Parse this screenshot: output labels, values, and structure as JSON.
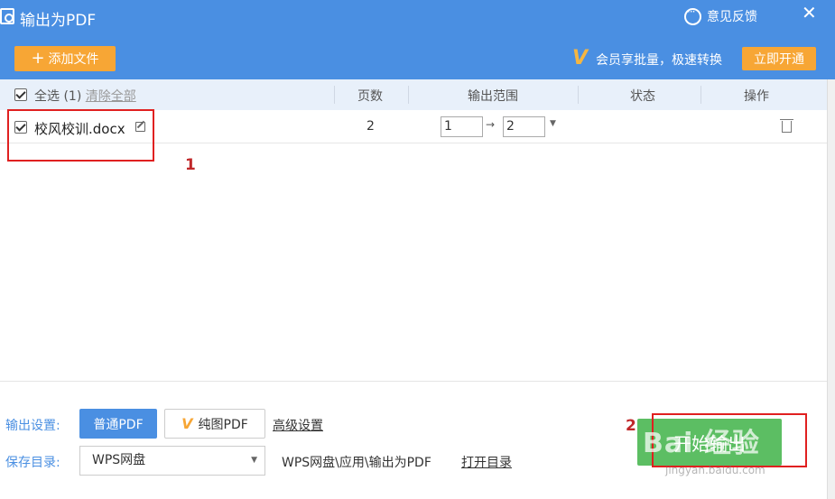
{
  "window": {
    "title": "输出为PDF",
    "feedback": "意见反馈",
    "close": "✕"
  },
  "toolbar": {
    "add_files": "添加文件",
    "vip_text": "会员享批量，极速转换",
    "open_vip": "立即开通"
  },
  "table": {
    "select_all": "全选 (1)",
    "clear_all": "清除全部",
    "columns": {
      "pages": "页数",
      "range": "输出范围",
      "status": "状态",
      "action": "操作"
    },
    "rows": [
      {
        "name": "校风校训.docx",
        "pages": "2",
        "range_from": "1",
        "range_to": "2",
        "checked": true
      }
    ]
  },
  "settings": {
    "output_label": "输出设置:",
    "mode_normal": "普通PDF",
    "mode_image": "纯图PDF",
    "advanced": "高级设置",
    "save_label": "保存目录:",
    "save_target": "WPS网盘",
    "save_path": "WPS网盘\\应用\\输出为PDF",
    "open_dir": "打开目录"
  },
  "start": {
    "label": "开始输出"
  },
  "annotations": {
    "n1": "1",
    "n2": "2",
    "color": "#e02020"
  },
  "watermark": {
    "text": "Bai 经验",
    "url": "jingyan.baidu.com"
  },
  "colors": {
    "header": "#4a8fe2",
    "accent": "#f7a635",
    "start": "#5cbe63"
  }
}
